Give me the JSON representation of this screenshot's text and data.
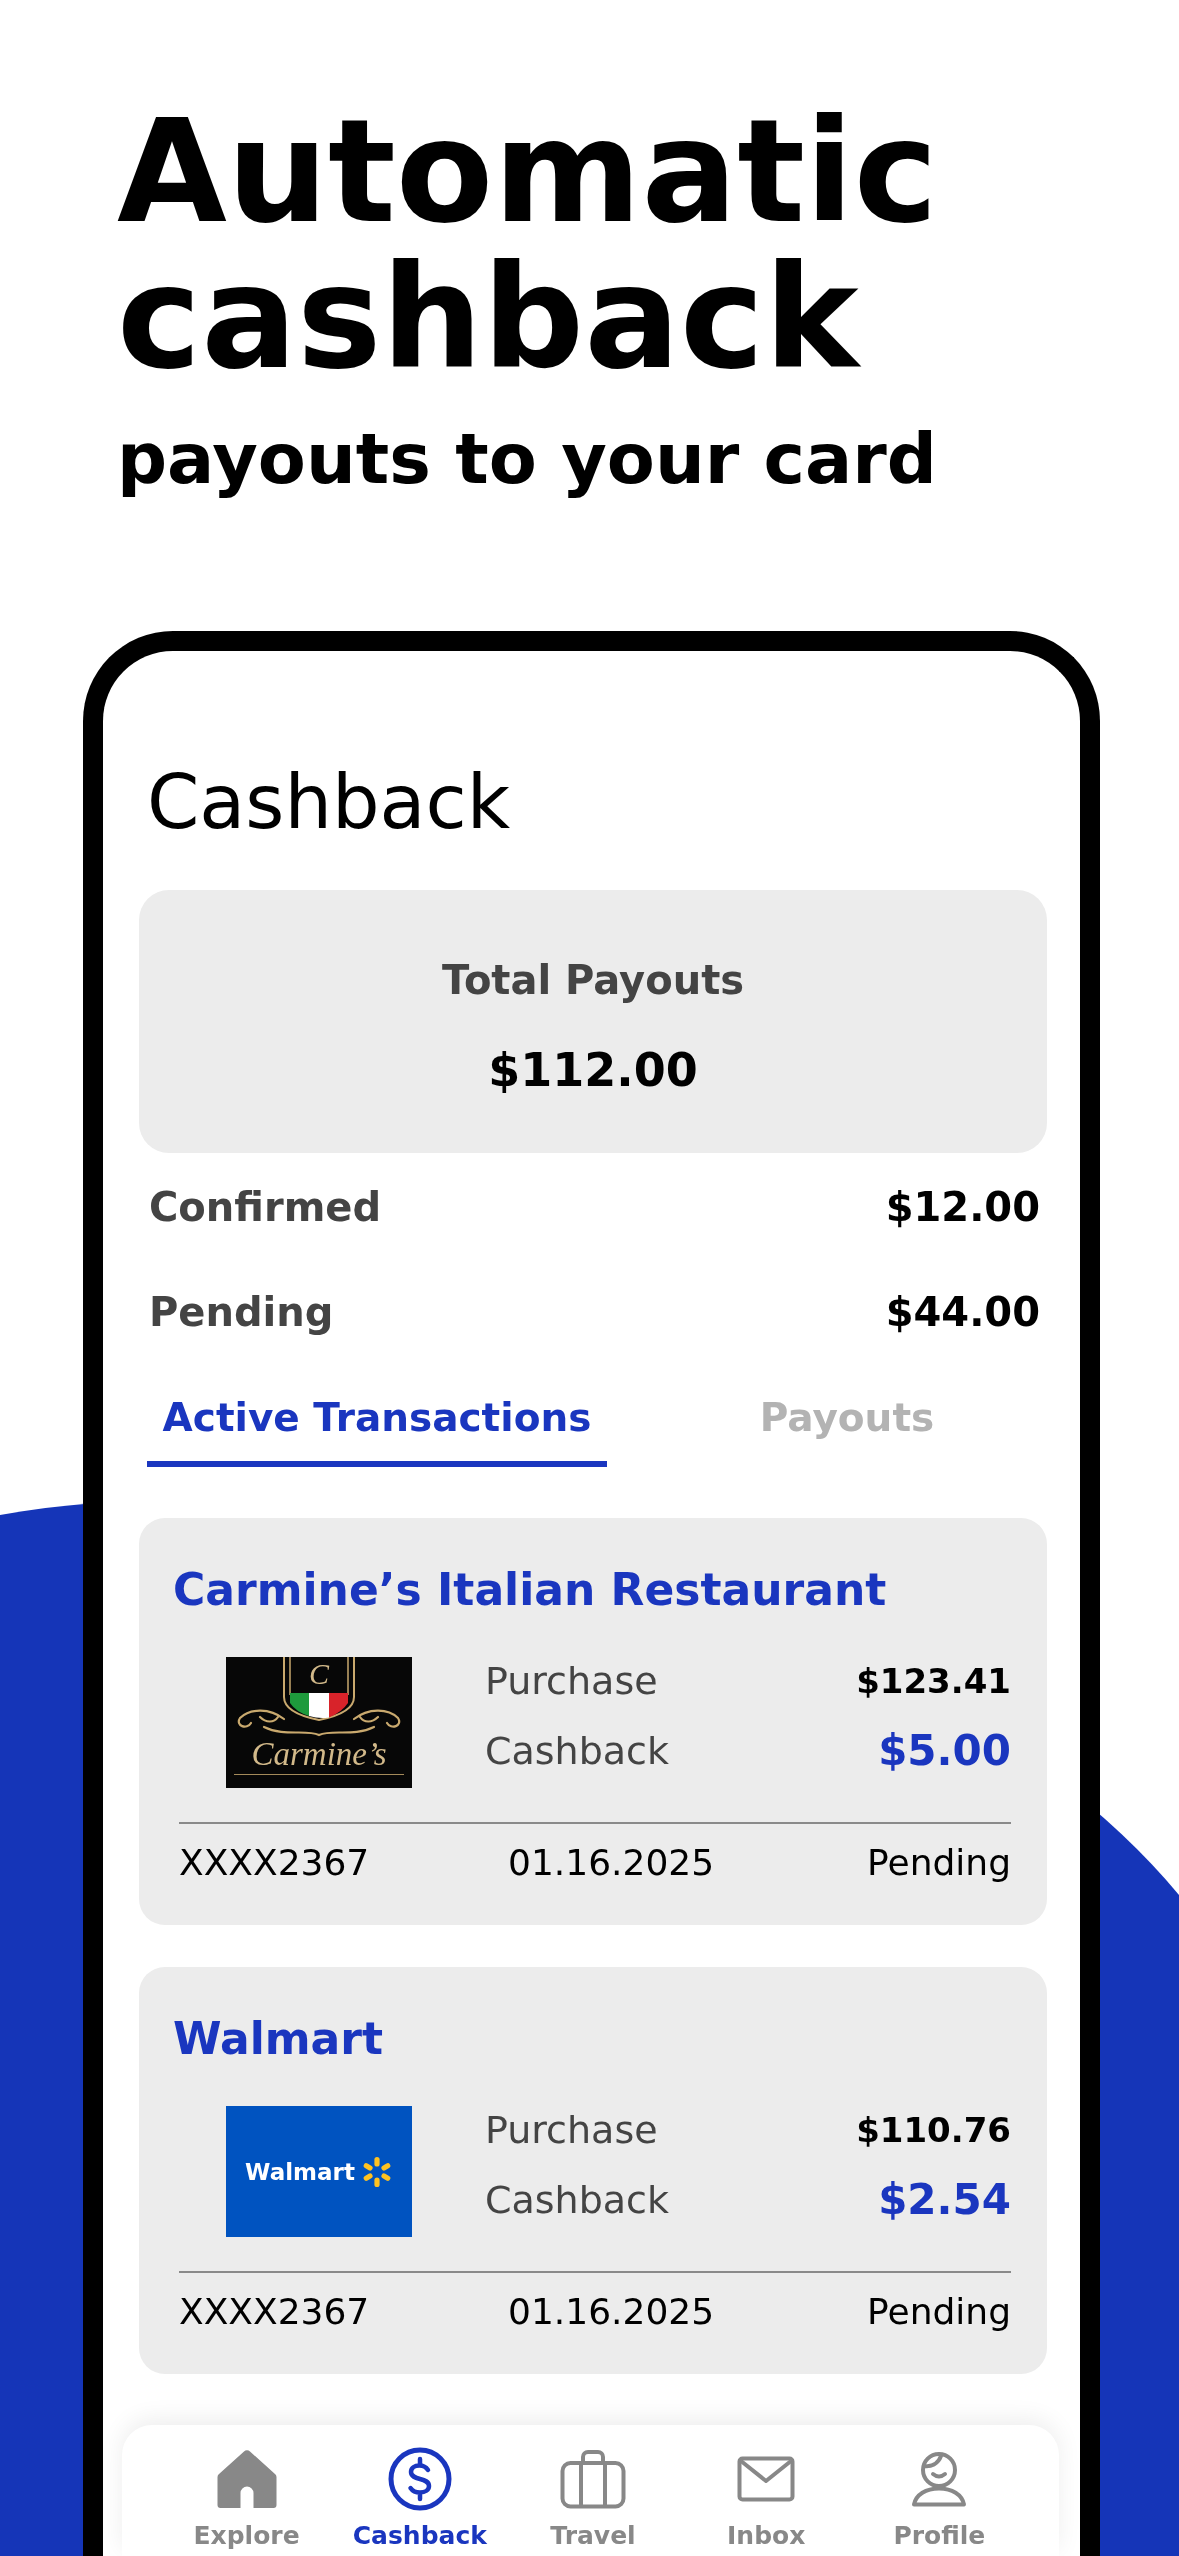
{
  "hero": {
    "title": "Automatic cashback",
    "subtitle": "payouts to your card"
  },
  "screen": {
    "title": "Cashback",
    "total": {
      "label": "Total Payouts",
      "amount": "$112.00"
    },
    "summary": [
      {
        "label": "Confirmed",
        "amount": "$12.00"
      },
      {
        "label": "Pending",
        "amount": "$44.00"
      }
    ],
    "tabs": [
      {
        "label": "Active Transactions",
        "selected": true
      },
      {
        "label": "Payouts",
        "selected": false
      }
    ],
    "transactions": [
      {
        "merchant": "Carmine’s Italian Restaurant",
        "logo": {
          "kind": "crest",
          "monogram": "C",
          "text": "Carmine’s"
        },
        "purchase_label": "Purchase",
        "purchase": "$123.41",
        "cashback_label": "Cashback",
        "cashback": "$5.00",
        "card": "XXXX2367",
        "date": "01.16.2025",
        "status": "Pending"
      },
      {
        "merchant": "Walmart",
        "logo": {
          "kind": "tile",
          "text": "Walmart"
        },
        "purchase_label": "Purchase",
        "purchase": "$110.76",
        "cashback_label": "Cashback",
        "cashback": "$2.54",
        "card": "XXXX2367",
        "date": "01.16.2025",
        "status": "Pending"
      }
    ],
    "nav": [
      {
        "label": "Explore",
        "selected": false
      },
      {
        "label": "Cashback",
        "selected": true
      },
      {
        "label": "Travel",
        "selected": false
      },
      {
        "label": "Inbox",
        "selected": false
      },
      {
        "label": "Profile",
        "selected": false
      }
    ]
  }
}
